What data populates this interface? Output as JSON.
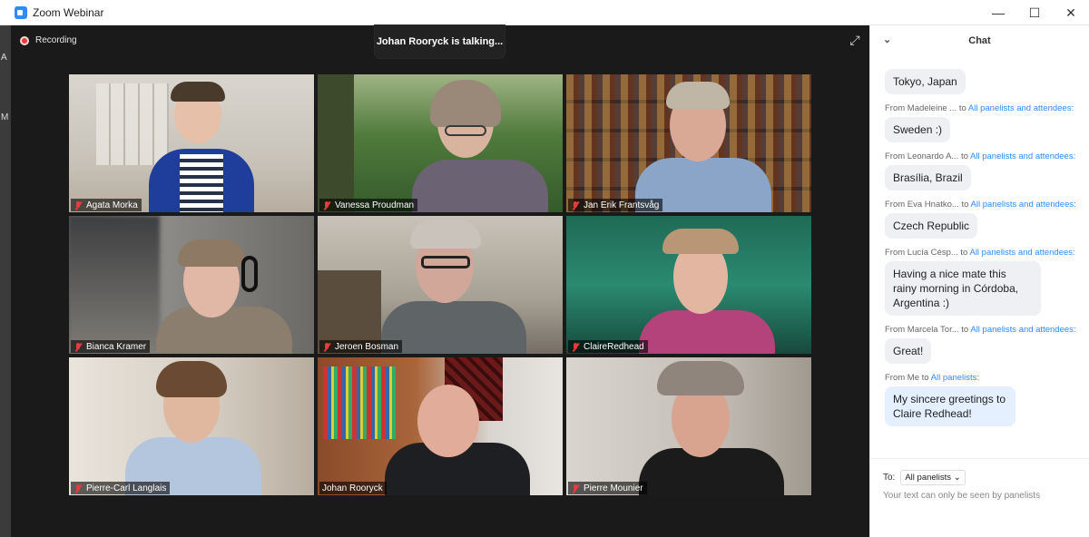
{
  "window": {
    "title": "Zoom Webinar",
    "controls": {
      "minimize": "—",
      "maximize": "☐",
      "close": "✕"
    }
  },
  "left_strip": {
    "top_letter": "A",
    "mid_letter": "M"
  },
  "recording": {
    "label": "Recording"
  },
  "talking": {
    "text": "Johan Rooryck is talking..."
  },
  "participants": [
    {
      "name": "Agata Morka",
      "muted": true
    },
    {
      "name": "Vanessa Proudman",
      "muted": true
    },
    {
      "name": "Jan Erik Frantsvåg",
      "muted": true
    },
    {
      "name": "Bianca Kramer",
      "muted": true
    },
    {
      "name": "Jeroen Bosman",
      "muted": true
    },
    {
      "name": "ClaireRedhead",
      "muted": true
    },
    {
      "name": "Pierre-Carl Langlais",
      "muted": true
    },
    {
      "name": "Johan Rooryck",
      "muted": false,
      "active_speaker": true
    },
    {
      "name": "Pierre Mounier",
      "muted": true
    }
  ],
  "chat": {
    "title": "Chat",
    "messages": [
      {
        "from": "",
        "to": "",
        "text": "Tokyo, Japan"
      },
      {
        "from": "From Madeleine ...",
        "to": "All panelists and attendees:",
        "text": "Sweden :)"
      },
      {
        "from": "From Leonardo A...",
        "to": "All panelists and attendees:",
        "text": "Brasília, Brazil"
      },
      {
        "from": "From Eva Hnatko...",
        "to": "All panelists and attendees:",
        "text": "Czech Republic"
      },
      {
        "from": "From Lucía Césp...",
        "to": "All panelists and attendees:",
        "text": "Having a nice mate this rainy morning in Córdoba, Argentina :)"
      },
      {
        "from": "From Marcela Tor...",
        "to": "All panelists and attendees:",
        "text": "Great!"
      },
      {
        "from": "From Me",
        "to": "All panelists:",
        "text": "My sincere greetings to Claire Redhead!",
        "mine": true
      }
    ],
    "to_word": "to",
    "recipient_label": "To:",
    "recipient_value": "All panelists",
    "hint": "Your text can only be seen by panelists"
  },
  "colors": {
    "accent": "#2d8cff",
    "active_border": "#ffe86b",
    "muted_icon": "#e43c3c"
  }
}
